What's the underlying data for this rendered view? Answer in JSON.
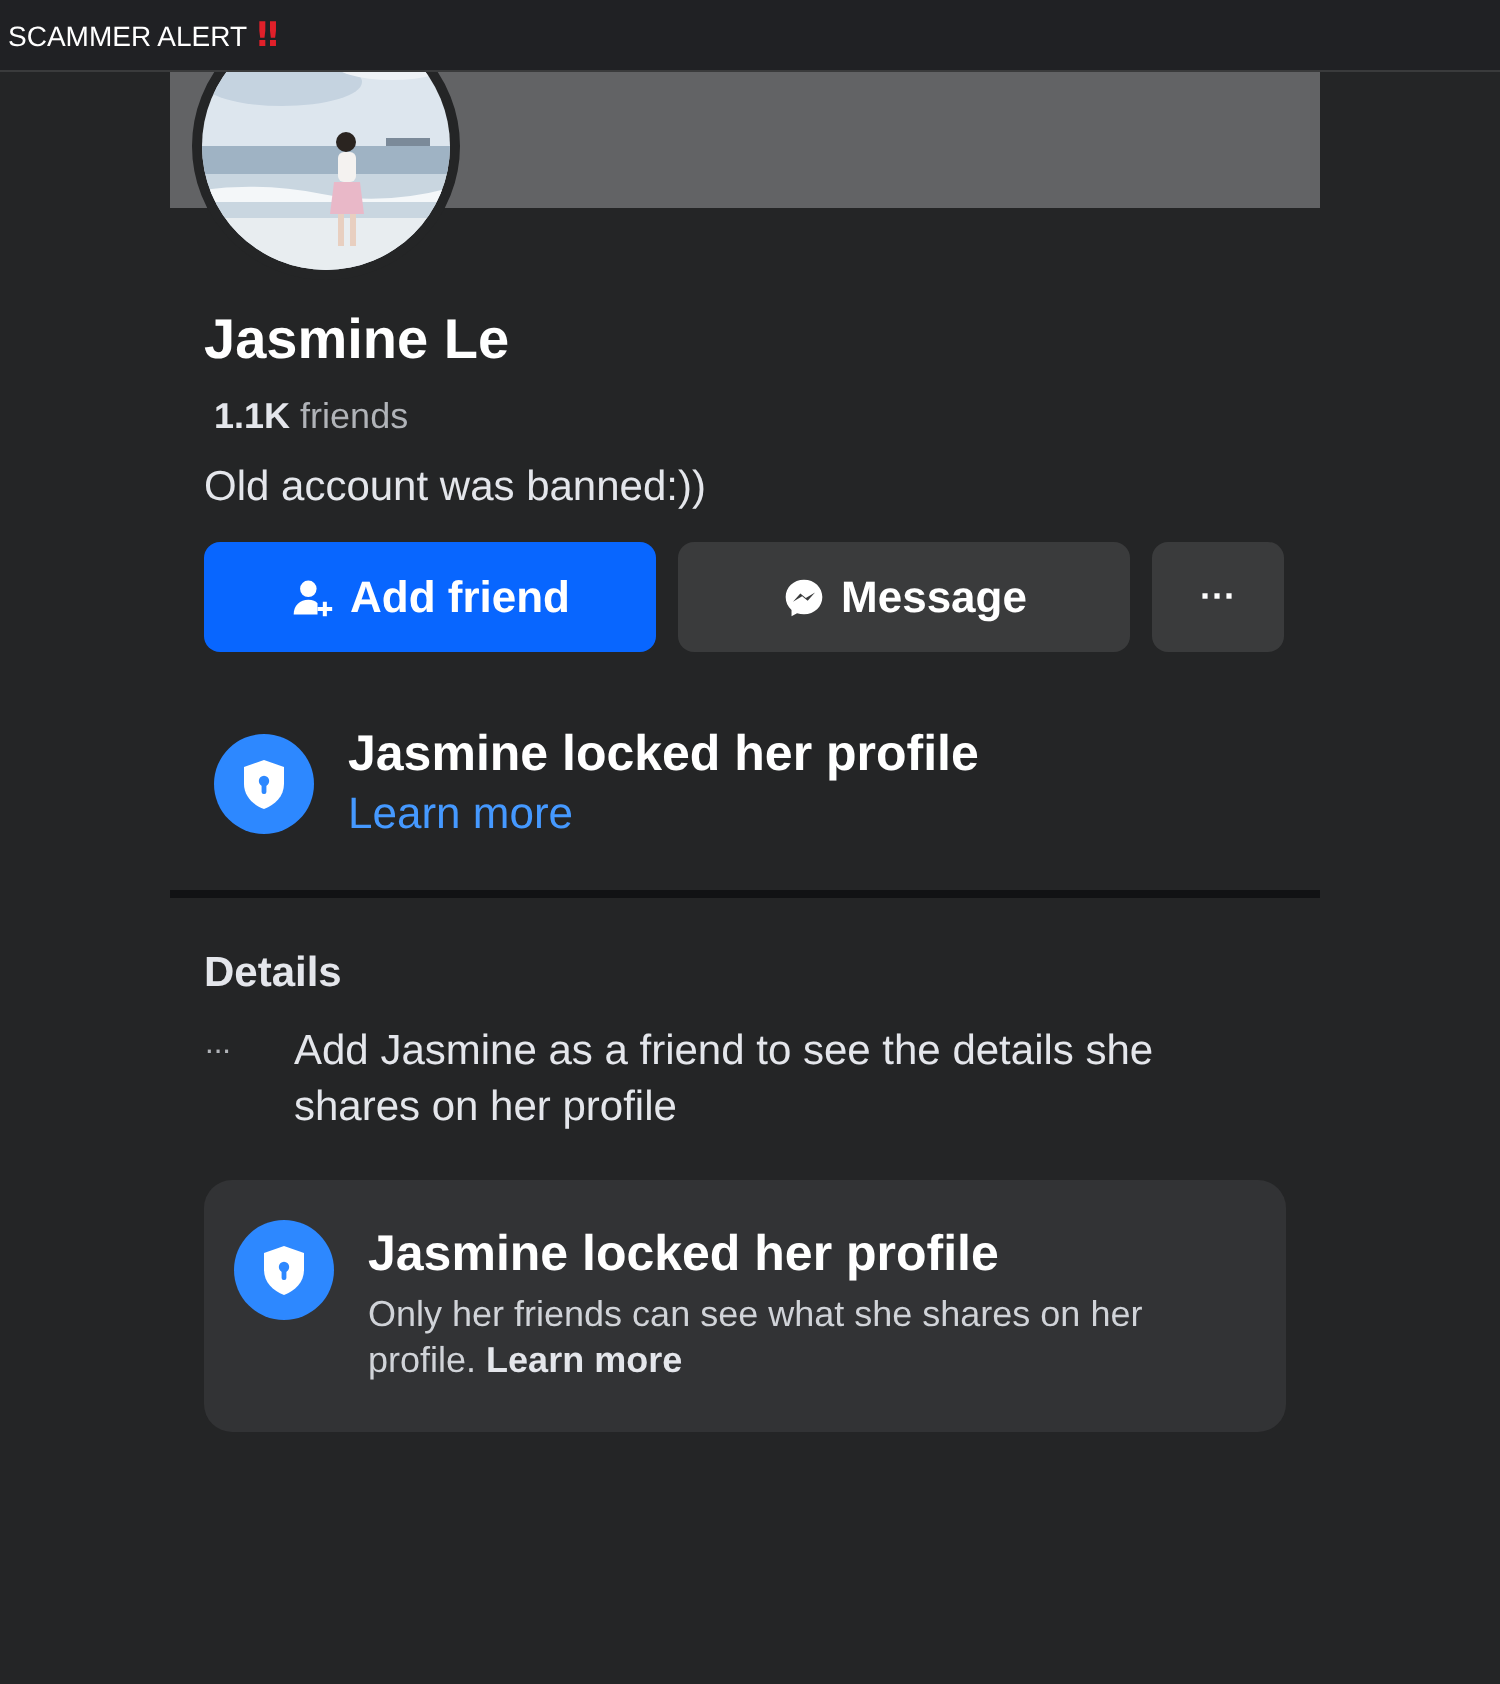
{
  "post": {
    "caption": "SCAMMER ALERT",
    "emoji": "‼"
  },
  "profile": {
    "name": "Jasmine Le",
    "friend_count": "1.1K",
    "friend_label": "friends",
    "bio": "Old account was banned:))"
  },
  "buttons": [
    {
      "kind": "primary",
      "label": "Add friend"
    },
    {
      "kind": "secondary",
      "label": "Message"
    },
    {
      "kind": "more",
      "label": "···"
    }
  ],
  "lock_notice": {
    "title": "Jasmine locked her profile",
    "link": "Learn more"
  },
  "details": {
    "heading": "Details",
    "marker": "···",
    "text": "Add Jasmine as a friend to see the details she shares on her profile"
  },
  "lock_card": {
    "title": "Jasmine locked her profile",
    "text": "Only her friends can see what she shares on her profile.",
    "link": "Learn more"
  }
}
